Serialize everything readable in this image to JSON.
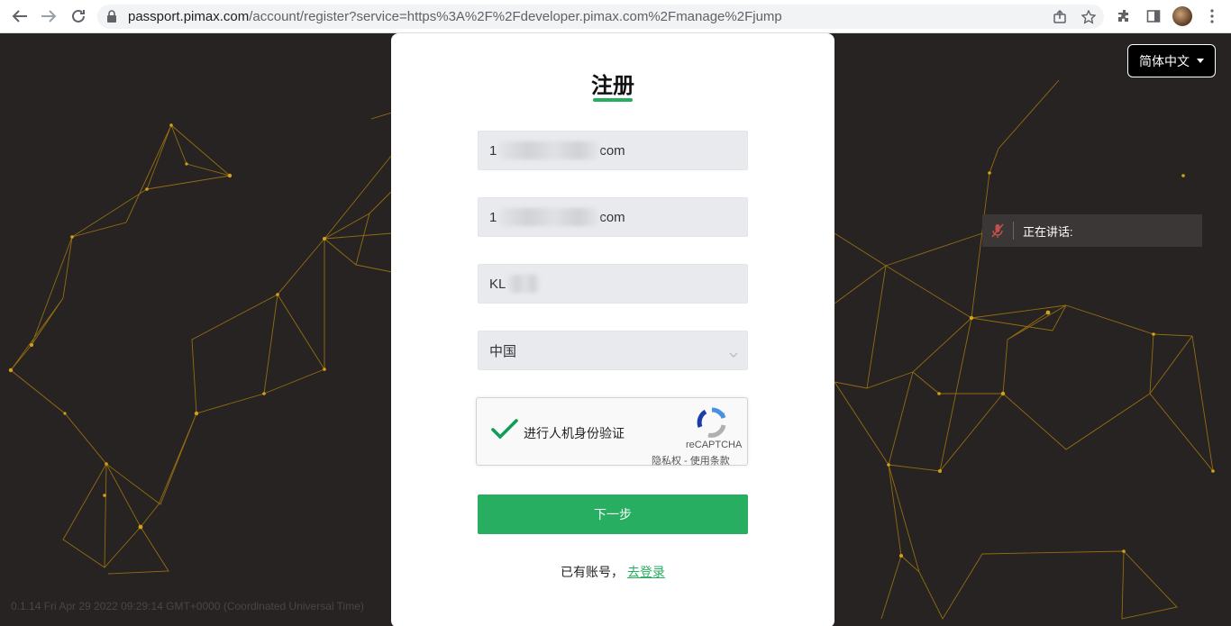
{
  "browser": {
    "url_host": "passport.pimax.com",
    "url_path": "/account/register?service=https%3A%2F%2Fdeveloper.pimax.com%2Fmanage%2Fjump"
  },
  "language_selector": {
    "label": "简体中文"
  },
  "speaking_indicator": {
    "label": "正在讲话:"
  },
  "version_text": "0.1.14 Fri Apr 29 2022 09:29:14 GMT+0000 (Coordinated Universal Time)",
  "form": {
    "title": "注册",
    "email": {
      "prefix": "1",
      "suffix": "com"
    },
    "confirm_email": {
      "prefix": "1",
      "suffix": "com"
    },
    "name": {
      "prefix": "KL"
    },
    "country": {
      "value": "中国"
    },
    "recaptcha": {
      "label": "进行人机身份验证",
      "brand": "reCAPTCHA",
      "privacy": "隐私权",
      "separator": " - ",
      "terms": "使用条款"
    },
    "next_button": "下一步",
    "has_account": "已有账号，",
    "login_link": "去登录"
  },
  "colors": {
    "accent": "#27ae60",
    "background": "#262322",
    "network_line": "#b8860b"
  },
  "icons": [
    "back-arrow-icon",
    "forward-arrow-icon",
    "reload-icon",
    "lock-icon",
    "share-icon",
    "star-icon",
    "extensions-icon",
    "sidebar-icon",
    "menu-icon",
    "chevron-down-icon",
    "checkmark-icon",
    "recaptcha-logo-icon",
    "mic-muted-icon"
  ]
}
